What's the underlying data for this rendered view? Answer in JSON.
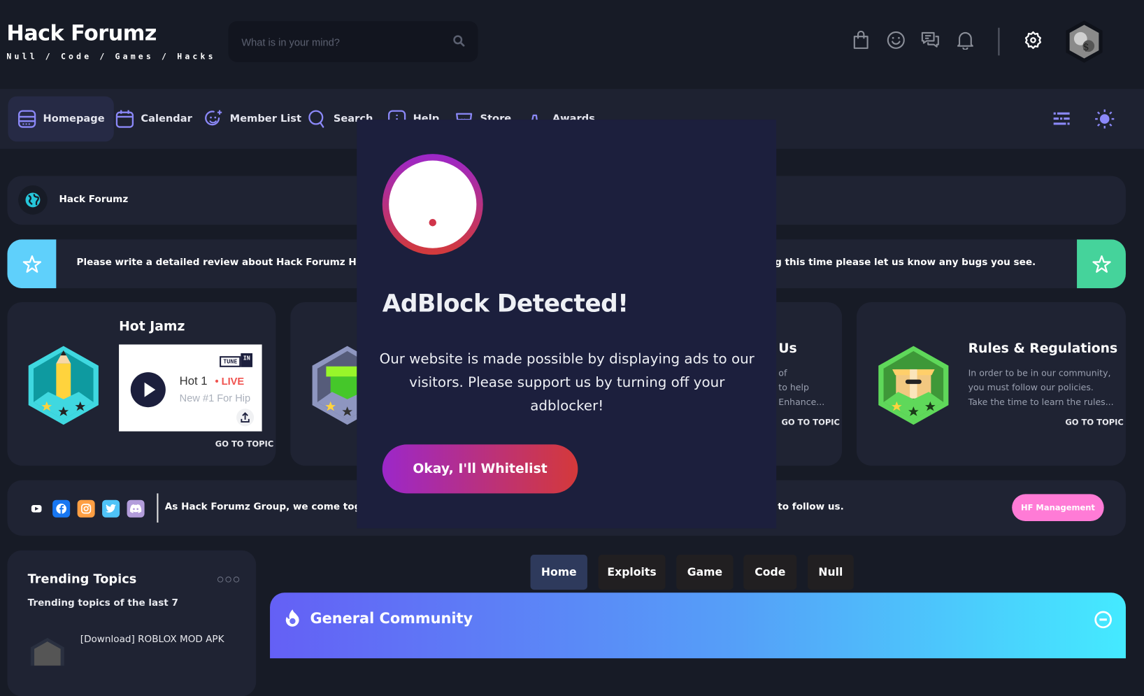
{
  "header": {
    "site_title": "Hack Forumz",
    "tagline": "Null / Code / Games / Hacks",
    "search_placeholder": "What is in your mind?",
    "icons": [
      "shopping-bag-icon",
      "smile-icon",
      "messages-icon",
      "bell-icon",
      "gear-icon",
      "avatar"
    ]
  },
  "nav": {
    "items": [
      {
        "label": "Homepage",
        "icon": "homepage-icon",
        "active": true
      },
      {
        "label": "Calendar",
        "icon": "calendar-icon"
      },
      {
        "label": "Member List",
        "icon": "member-list-icon"
      },
      {
        "label": "Search",
        "icon": "search-icon"
      },
      {
        "label": "Help",
        "icon": "help-icon"
      },
      {
        "label": "Store",
        "icon": "store-icon"
      },
      {
        "label": "Awards",
        "icon": "awards-icon"
      }
    ],
    "right_icons": [
      "menu-lines-icon",
      "sun-icon"
    ]
  },
  "breadcrumb": {
    "label": "Hack Forumz"
  },
  "announcement": {
    "left_text": "Please write a detailed review about Hack Forumz Here !",
    "right_text": "g this time please let us know any bugs you see.",
    "left_color": "#5fd0fb",
    "right_color": "#45d39b"
  },
  "cards": [
    {
      "title": "Hot Jamz",
      "widget": {
        "brand_tune": "TUNE",
        "brand_in": "IN",
        "station": "Hot 1",
        "live": "• LIVE",
        "subtitle": "New #1 For Hip"
      },
      "cta": "GO TO TOPIC"
    },
    {
      "title": "Us",
      "desc": [
        "of",
        "to help",
        "Enhance..."
      ],
      "cta": "GO TO TOPIC"
    },
    {
      "title": "Rules & Regulations",
      "desc": [
        "In order to be in our community,",
        "you must follow our policies.",
        "Take the time to learn the rules..."
      ],
      "cta": "GO TO TOPIC"
    }
  ],
  "social": {
    "icons": [
      "youtube-icon",
      "facebook-icon",
      "instagram-icon",
      "twitter-icon",
      "discord-icon"
    ],
    "left_text": "As Hack Forumz Group, we come together",
    "right_text": "to follow us.",
    "button": "HF Management"
  },
  "trending": {
    "title": "Trending Topics",
    "subtitle": "Trending topics of the last 7",
    "items": [
      "[Download] ROBLOX MOD APK"
    ]
  },
  "tabs": [
    {
      "label": "Home",
      "active": true
    },
    {
      "label": "Exploits"
    },
    {
      "label": "Game"
    },
    {
      "label": "Code"
    },
    {
      "label": "Null"
    }
  ],
  "forum": {
    "title": "General Community"
  },
  "modal": {
    "title": "AdBlock Detected!",
    "body": "Our website is made possible by displaying ads to our visitors. Please support us by turning off your adblocker!",
    "button": "Okay, I'll Whitelist"
  }
}
